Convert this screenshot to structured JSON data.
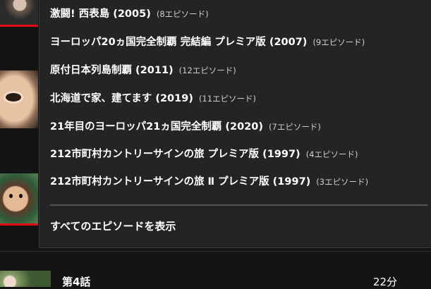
{
  "menu": {
    "items": [
      {
        "title": "激闘! 西表島 (2005)",
        "count": "(8エピソード)"
      },
      {
        "title": "ヨーロッパ20ヵ国完全制覇 完結編 プレミア版 (2007)",
        "count": "(9エピソード)"
      },
      {
        "title": "原付日本列島制覇 (2011)",
        "count": "(12エピソード)"
      },
      {
        "title": "北海道で家、建てます (2019)",
        "count": "(11エピソード)"
      },
      {
        "title": "21年目のヨーロッパ21ヵ国完全制覇 (2020)",
        "count": "(7エピソード)"
      },
      {
        "title": "212市町村カントリーサインの旅 プレミア版 (1997)",
        "count": "(4エピソード)"
      },
      {
        "title": "212市町村カントリーサインの旅 Ⅱ プレミア版 (1997)",
        "count": "(3エピソード)"
      }
    ],
    "show_all_label": "すべてのエピソードを表示"
  },
  "episode": {
    "title": "第4話",
    "duration": "22分"
  },
  "colors": {
    "background": "#141414",
    "menu_background": "#242424",
    "progress_red": "#e50914"
  }
}
